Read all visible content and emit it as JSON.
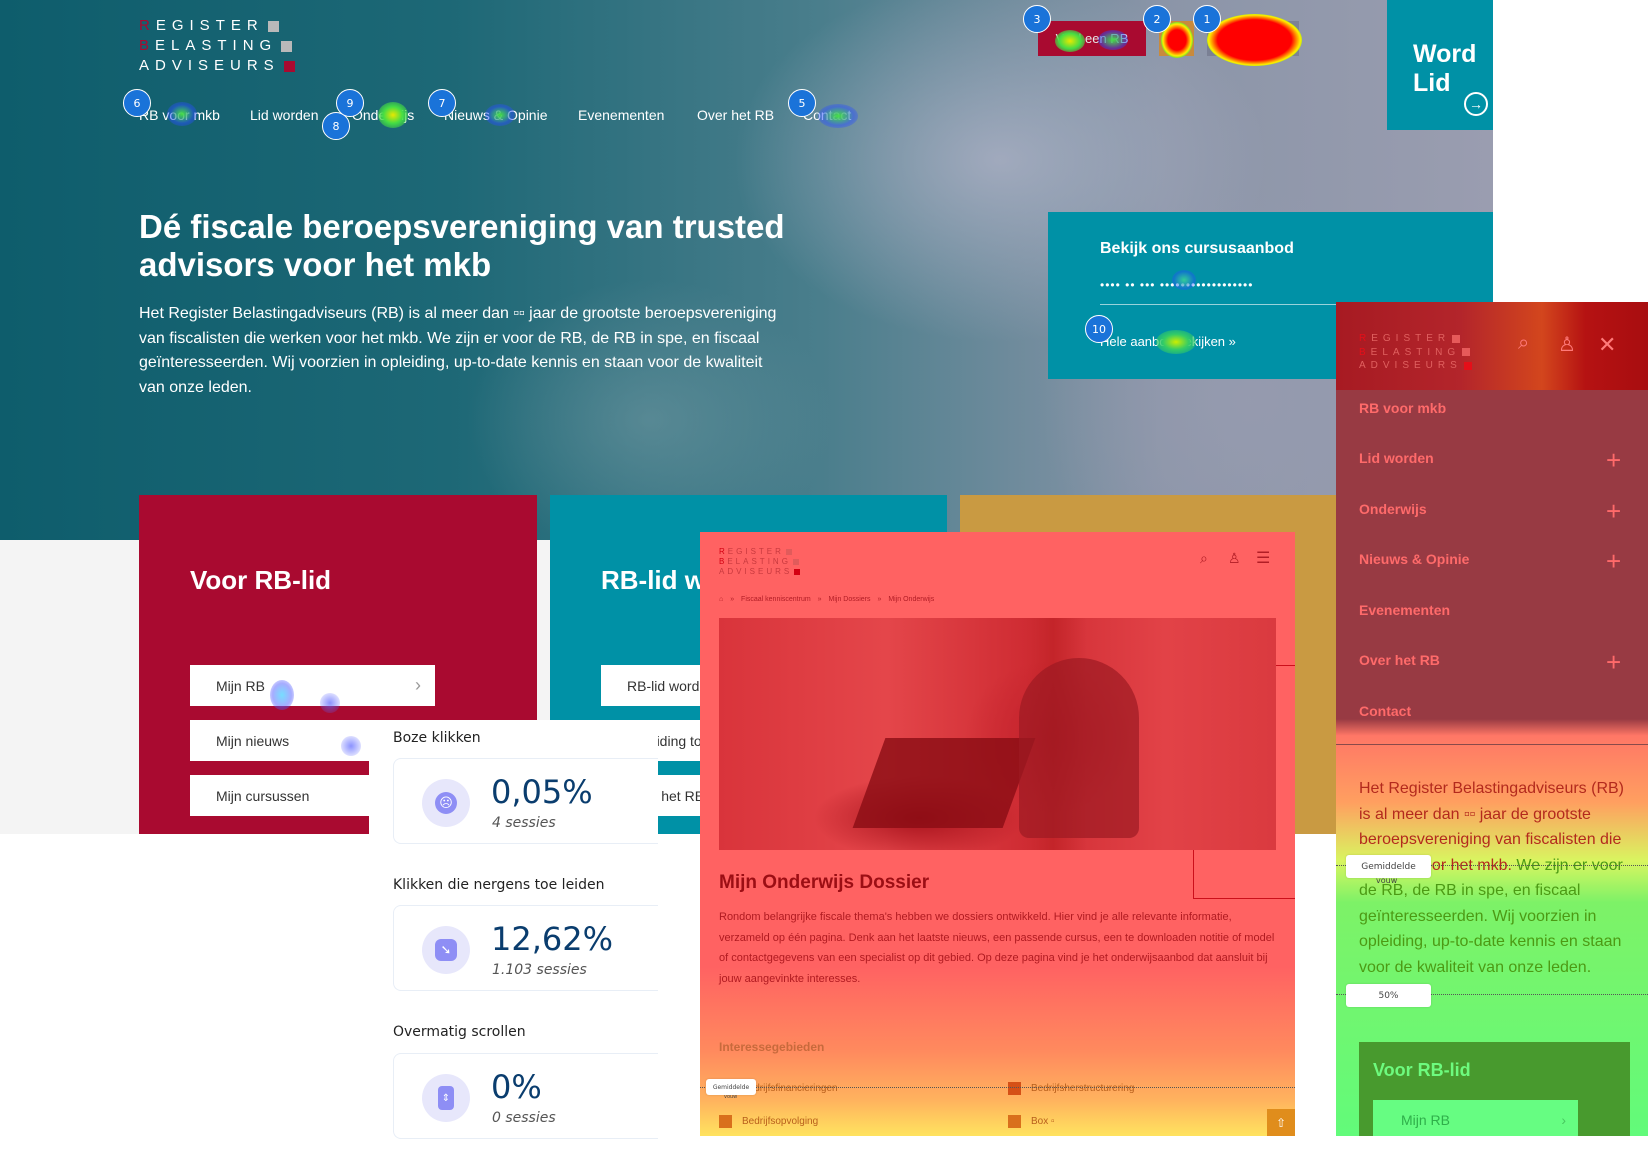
{
  "desktop": {
    "logo": {
      "lines": [
        {
          "first": "R",
          "rest": "EGISTER",
          "square": "grey"
        },
        {
          "first": "B",
          "rest": "ELASTING",
          "square": "grey"
        },
        {
          "first": "",
          "rest": "ADVISEURS",
          "square": "red"
        }
      ]
    },
    "nav": [
      "RB voor mkb",
      "Lid worden",
      "Onderwijs",
      "Nieuws & Opinie",
      "Evenementen",
      "Over het RB",
      "Contact"
    ],
    "top_buttons": {
      "find": "Vind een RB"
    },
    "word_lid": {
      "label_line1": "Word",
      "label_line2": "Lid",
      "arrow": "→"
    },
    "hero": {
      "title": "Dé fiscale beroepsvereniging van trusted advisors voor het mkb",
      "text": "Het Register Belastingadviseurs (RB) is al meer dan ▫▫ jaar de grootste beroepsvereniging van fiscalisten die werken voor het mkb. We zijn er voor de RB, de RB in spe, en fiscaal geïnteresseerden. Wij voorzien in opleiding, up-to-date kennis en staan voor de kwaliteit van onze leden."
    },
    "course_box": {
      "title": "Bekijk ons cursusaanbod",
      "masked_input": "•••• •• ••• ••••••••••••••••••",
      "link": "Hele aanbod bekijken »"
    },
    "cards": [
      {
        "title": "Voor RB-lid",
        "buttons": [
          "Mijn RB",
          "Mijn nieuws",
          "Mijn cursussen"
        ],
        "color": "#a90a30"
      },
      {
        "title": "RB-lid worden",
        "buttons": [
          "RB-lid worden",
          "Opleiding tot RB",
          "Over het RB"
        ],
        "color": "#0091a6"
      },
      {
        "title": "",
        "buttons": [],
        "color": "#c99a42"
      }
    ],
    "heatmap_pins": [
      "1",
      "2",
      "3",
      "5",
      "6",
      "7",
      "8",
      "9",
      "10"
    ]
  },
  "stats": {
    "items": [
      {
        "label": "Boze klikken",
        "value": "0,05%",
        "sessions": "4 sessies",
        "icon": "angry-face-icon"
      },
      {
        "label": "Klikken die nergens toe leiden",
        "value": "12,62%",
        "sessions": "1.103 sessies",
        "icon": "dead-click-icon"
      },
      {
        "label": "Overmatig scrollen",
        "value": "0%",
        "sessions": "0 sessies",
        "icon": "scroll-icon"
      }
    ]
  },
  "dossier": {
    "logo": {
      "lines": [
        {
          "first": "R",
          "rest": "EGISTER",
          "square": "grey"
        },
        {
          "first": "B",
          "rest": "ELASTING",
          "square": "grey"
        },
        {
          "first": "",
          "rest": "ADVISEURS",
          "square": "red"
        }
      ]
    },
    "breadcrumb": [
      "Fiscaal kenniscentrum",
      "Mijn Dossiers",
      "Mijn Onderwijs"
    ],
    "breadcrumb_sep": "»",
    "title": "Mijn Onderwijs Dossier",
    "description": "Rondom belangrijke fiscale thema's hebben we dossiers ontwikkeld. Hier vind je alle relevante informatie, verzameld op één pagina. Denk aan het laatste nieuws, een passende cursus, een te downloaden notitie of model of contactgegevens van een specialist op dit gebied. Op deze pagina vind je het onderwijsaanbod dat aansluit bij jouw aangevinkte interesses.",
    "interests_title": "Interessegebieden",
    "interests": [
      "Bedrijfsfinancieringen",
      "Bedrijfsherstructurering",
      "Bedrijfsopvolging",
      "Box ▫"
    ],
    "fold_label": "Gemiddelde",
    "fold_sub": "vouw"
  },
  "menu": {
    "logo": {
      "lines": [
        {
          "first": "R",
          "rest": "EGISTER",
          "square": "grey"
        },
        {
          "first": "B",
          "rest": "ELASTING",
          "square": "grey"
        },
        {
          "first": "",
          "rest": "ADVISEURS",
          "square": "red"
        }
      ]
    },
    "items": [
      {
        "label": "RB voor mkb",
        "expandable": false
      },
      {
        "label": "Lid worden",
        "expandable": true
      },
      {
        "label": "Onderwijs",
        "expandable": true
      },
      {
        "label": "Nieuws & Opinie",
        "expandable": true
      },
      {
        "label": "Evenementen",
        "expandable": false
      },
      {
        "label": "Over het RB",
        "expandable": true
      },
      {
        "label": "Contact",
        "expandable": false
      }
    ],
    "plus": "+",
    "para_top": "Het Register Belastingadviseurs (RB) is al meer dan ▫▫ jaar de grootste beroepsvereniging van fiscalisten die werken voor het mkb.",
    "para_bottom": "We zijn er voor de RB, de RB in spe, en fiscaal geïnteresseerden. Wij voorzien in opleiding, up-to-date kennis en staan voor de kwaliteit van onze leden.",
    "fold_label": "Gemiddelde",
    "fold_sub": "vouw",
    "half_label": "50%",
    "card_title": "Voor RB-lid",
    "card_button": "Mijn RB"
  },
  "colors": {
    "brand_red": "#a90a30",
    "brand_teal": "#0091a6",
    "brand_gold": "#c99a42",
    "stat_value": "#0a3d6e",
    "pin_blue": "#1a73d9"
  }
}
